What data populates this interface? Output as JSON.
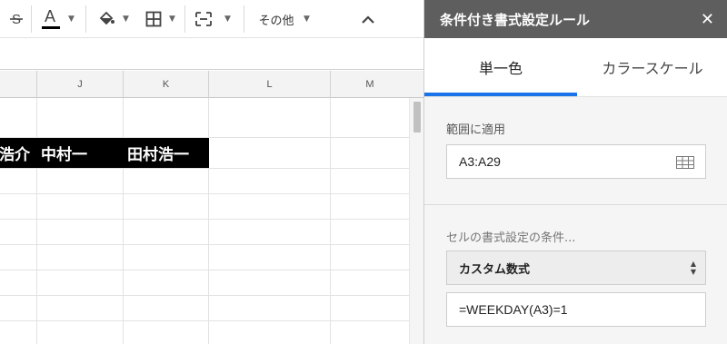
{
  "toolbar": {
    "icons": [
      "strikethrough-icon",
      "text-color-icon",
      "fill-color-icon",
      "borders-icon",
      "merge-cells-icon",
      "collapse-icon"
    ],
    "text_color_letter": "A",
    "more_label": "その他"
  },
  "grid": {
    "columns": [
      "J",
      "K",
      "L",
      "M"
    ],
    "highlighted_row": [
      "浩介",
      "中村一",
      "田村浩一"
    ]
  },
  "panel": {
    "title": "条件付き書式設定ルール",
    "close_glyph": "✕",
    "tabs": [
      "単一色",
      "カラースケール"
    ],
    "active_tab": "単一色",
    "range_label": "範囲に適用",
    "range_value": "A3:A29",
    "condition_label": "セルの書式設定の条件...",
    "condition_select": "カスタム数式",
    "formula_value": "=WEEKDAY(A3)=1"
  },
  "colors": {
    "panel_header": "#5e5e5e",
    "active_tab_underline": "#1a73e8",
    "highlight_fill": "#000000"
  }
}
